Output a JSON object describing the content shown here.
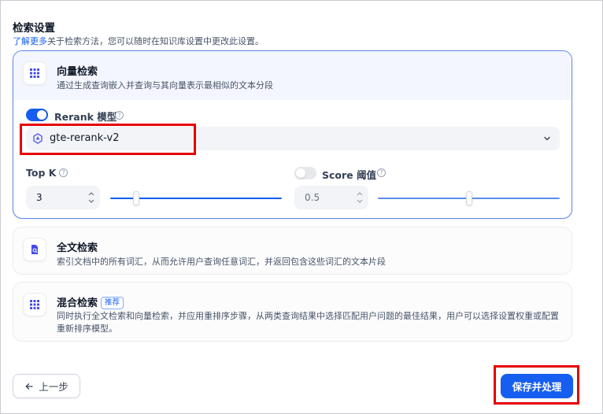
{
  "header": {
    "title": "检索设置",
    "link_text": "了解更多",
    "description": "关于检索方法，您可以随时在知识库设置中更改此设置。"
  },
  "vector_search": {
    "title": "向量检索",
    "description": "通过生成查询嵌入并查询与其向量表示最相似的文本分段",
    "rerank": {
      "enabled": true,
      "label": "Rerank 模型",
      "model": "gte-rerank-v2"
    },
    "top_k": {
      "label": "Top K",
      "value": "3",
      "slider_fraction": 0.15
    },
    "score_threshold": {
      "enabled": false,
      "label": "Score 阈值",
      "value": "0.5",
      "slider_fraction": 0.5
    }
  },
  "fulltext_search": {
    "title": "全文检索",
    "description": "索引文档中的所有词汇，从而允许用户查询任意词汇，并返回包含这些词汇的文本片段"
  },
  "hybrid_search": {
    "title": "混合检索",
    "badge": "推荐",
    "description": "同时执行全文检索和向量检索，并应用重排序步骤，从两类查询结果中选择匹配用户问题的最佳结果，用户可以选择设置权重或配置重新排序模型。"
  },
  "footer": {
    "back_label": "上一步",
    "save_label": "保存并处理"
  },
  "colors": {
    "accent": "#155eef",
    "highlight": "#e60000"
  }
}
